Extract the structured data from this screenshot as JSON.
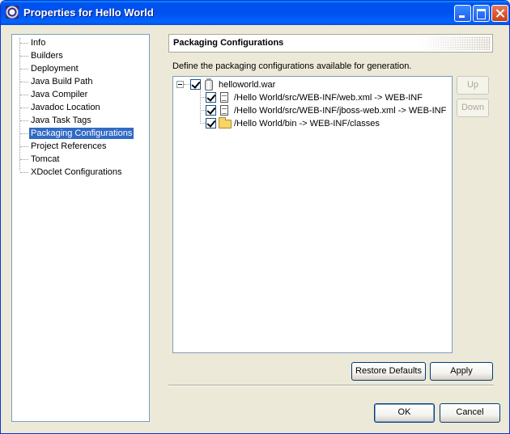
{
  "window": {
    "title": "Properties for Hello World",
    "controls": [
      "minimize-icon",
      "maximize-icon",
      "close-icon"
    ]
  },
  "nav": {
    "items": [
      {
        "label": "Info"
      },
      {
        "label": "Builders"
      },
      {
        "label": "Deployment"
      },
      {
        "label": "Java Build Path"
      },
      {
        "label": "Java Compiler"
      },
      {
        "label": "Javadoc Location"
      },
      {
        "label": "Java Task Tags"
      },
      {
        "label": "Packaging Configurations",
        "selected": true
      },
      {
        "label": "Project References"
      },
      {
        "label": "Tomcat"
      },
      {
        "label": "XDoclet Configurations"
      }
    ]
  },
  "panel": {
    "title": "Packaging Configurations",
    "description": "Define the packaging configurations available for generation."
  },
  "tree": {
    "root": {
      "label": "helloworld.war",
      "checked": true,
      "expanded": true,
      "icon": "jar-icon"
    },
    "children": [
      {
        "label": "/Hello World/src/WEB-INF/web.xml -> WEB-INF",
        "checked": true,
        "icon": "file-icon"
      },
      {
        "label": "/Hello World/src/WEB-INF/jboss-web.xml -> WEB-INF",
        "checked": true,
        "icon": "file-icon"
      },
      {
        "label": "/Hello World/bin -> WEB-INF/classes",
        "checked": true,
        "icon": "folder-icon"
      }
    ]
  },
  "side_buttons": {
    "up": "Up",
    "down": "Down"
  },
  "buttons": {
    "restore_defaults": "Restore Defaults",
    "apply": "Apply",
    "ok": "OK",
    "cancel": "Cancel"
  },
  "colors": {
    "title_bar": "#0054e3",
    "selection": "#316ac5",
    "check_mark": "#21a121",
    "dialog_bg": "#ece9d8"
  }
}
